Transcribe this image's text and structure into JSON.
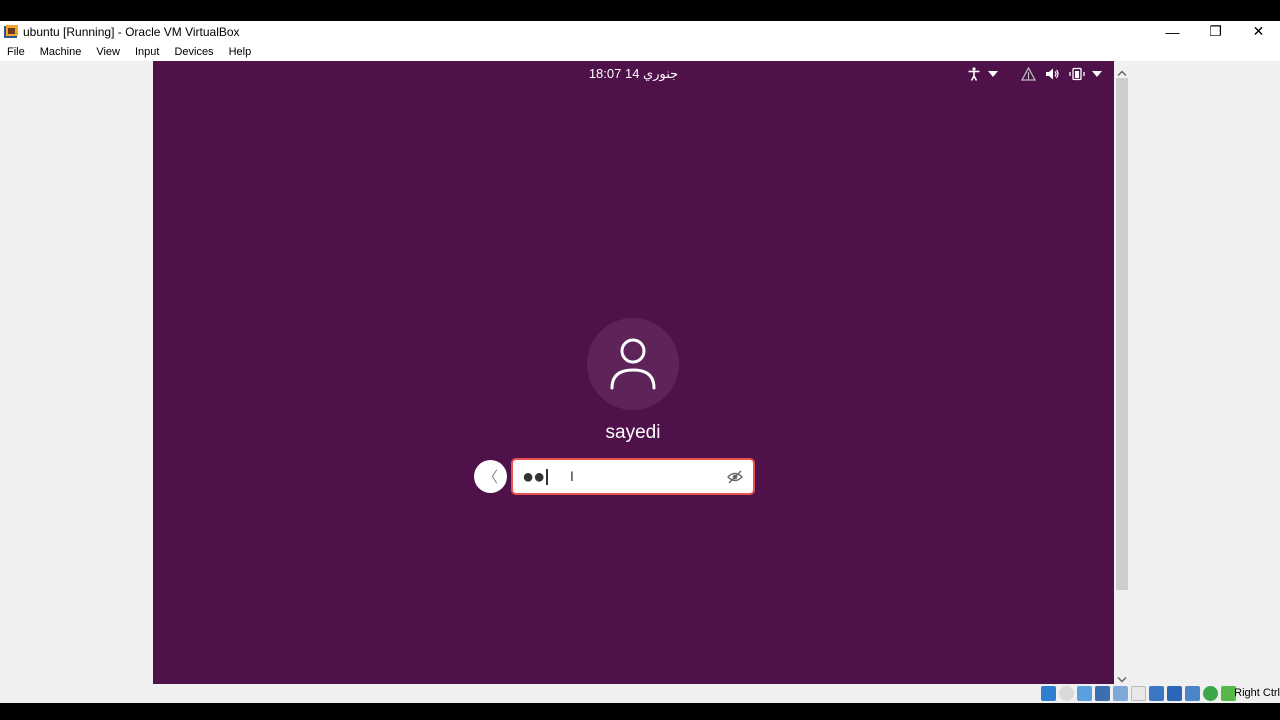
{
  "window": {
    "title": "ubuntu [Running] - Oracle VM VirtualBox",
    "controls": {
      "minimize": "—",
      "restore": "❐",
      "close": "✕"
    }
  },
  "menubar": {
    "items": [
      "File",
      "Machine",
      "View",
      "Input",
      "Devices",
      "Help"
    ]
  },
  "vm": {
    "top_bar": {
      "clock": "18:07  جنوري 14",
      "tray_icons": [
        "accessibility-icon",
        "dropdown-arrow-icon",
        "network-icon",
        "volume-icon",
        "battery-icon",
        "dropdown-arrow-icon"
      ]
    },
    "login": {
      "username": "sayedi",
      "password_mask": "●●",
      "back_button_glyph": "〈",
      "reveal_icon": "eye-slash-icon"
    }
  },
  "statusbar": {
    "host_key": "Right Ctrl",
    "icons": [
      "hard-disk-icon",
      "optical-drive-icon",
      "audio-icon",
      "network-adapter-icon",
      "usb-icon",
      "shared-folders-icon",
      "display-icon",
      "video-capture-icon",
      "recording-icon",
      "mouse-integration-icon",
      "keyboard-icon"
    ]
  },
  "colors": {
    "vm_background": "#4e1149",
    "avatar_background": "#5e2358",
    "password_border": "#e8534e"
  }
}
